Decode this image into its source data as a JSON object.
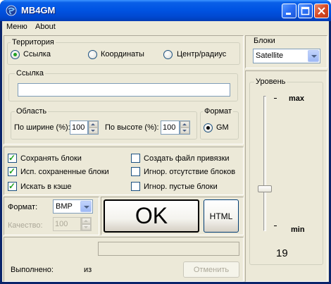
{
  "window": {
    "title": "MB4GM"
  },
  "menu": [
    {
      "label": "Меню"
    },
    {
      "label": "About"
    }
  ],
  "territory": {
    "label": "Территория",
    "options": [
      {
        "label": "Ссылка",
        "checked": true
      },
      {
        "label": "Координаты",
        "checked": false
      },
      {
        "label": "Центр/радиус",
        "checked": false
      }
    ]
  },
  "link": {
    "label": "Ссылка",
    "value": ""
  },
  "area": {
    "label": "Область",
    "width_label": "По ширине (%):",
    "width_value": "100",
    "height_label": "По высоте (%):",
    "height_value": "100"
  },
  "format_group": {
    "label": "Формат",
    "option": "GM",
    "checked": true
  },
  "checks_left": [
    {
      "label": "Сохранять блоки",
      "checked": true
    },
    {
      "label": "Исп. сохраненные блоки",
      "checked": true
    },
    {
      "label": "Искать в кэше",
      "checked": true
    }
  ],
  "checks_right": [
    {
      "label": "Создать файл привязки",
      "checked": false
    },
    {
      "label": "Игнор. отсутствие блоков",
      "checked": false
    },
    {
      "label": "Игнор. пустые блоки",
      "checked": false
    }
  ],
  "output": {
    "format_label": "Формат:",
    "format_value": "BMP",
    "quality_label": "Качество:",
    "quality_value": "100"
  },
  "buttons": {
    "ok": "OK",
    "html": "HTML",
    "cancel": "Отменить"
  },
  "status": {
    "done_label": "Выполнено:",
    "of_label": "из"
  },
  "blocks": {
    "label": "Блоки",
    "value": "Satellite"
  },
  "level": {
    "label": "Уровень",
    "max_label": "max",
    "min_label": "min",
    "value": "19",
    "fraction": 0.71
  },
  "colors": {
    "title_bar": "#0054e3",
    "face": "#ece9d8",
    "check_mark": "#21a121"
  }
}
